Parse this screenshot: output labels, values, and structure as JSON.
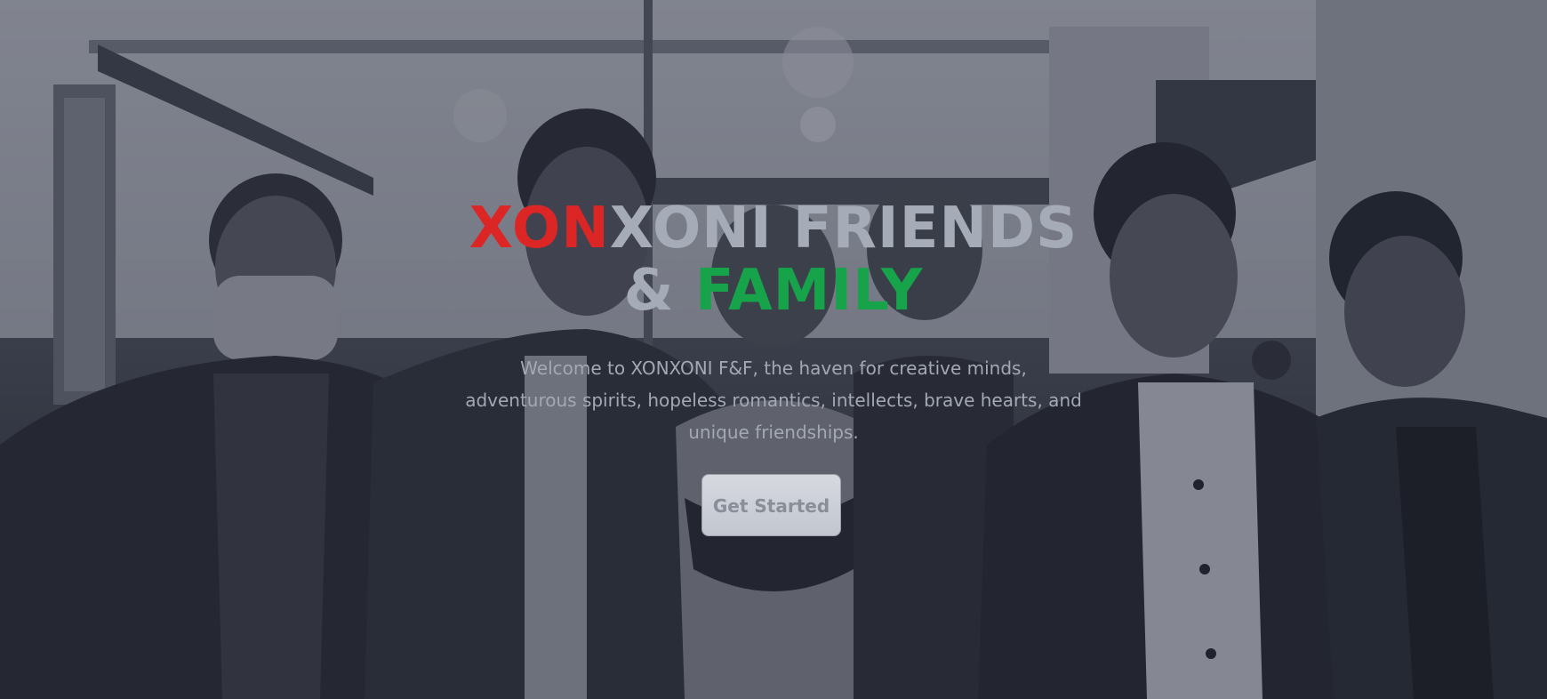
{
  "hero": {
    "title_red": "XON",
    "title_gray": "XONI FRIENDS",
    "title_amp": "& ",
    "title_green": "FAMILY",
    "subtitle": "Welcome to XONXONI F&F, the haven for creative minds, adventurous spirits, hopeless romantics, intellects, brave hearts, and unique friendships.",
    "cta_label": "Get Started"
  },
  "colors": {
    "red_accent": "#dc2626",
    "green_accent": "#16a34a",
    "title_gray": "#a6abb8",
    "button_bg": "#d0d3da"
  }
}
